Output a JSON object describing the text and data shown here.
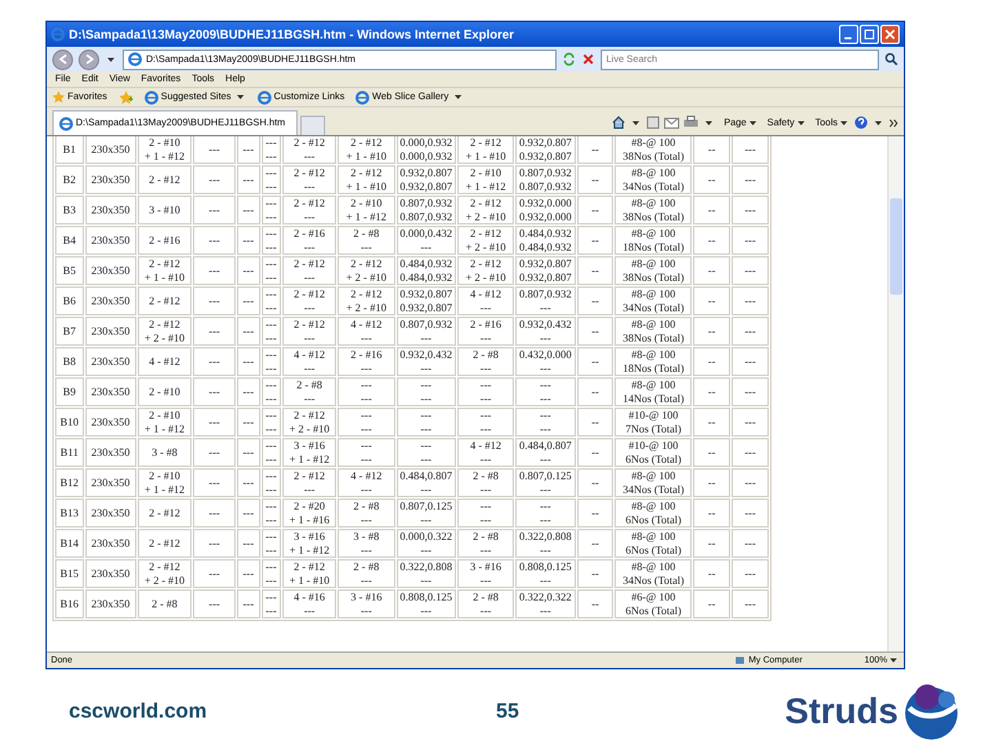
{
  "window": {
    "title": "D:\\Sampada1\\13May2009\\BUDHEJ11BGSH.htm - Windows Internet Explorer"
  },
  "address_bar": {
    "value": "D:\\Sampada1\\13May2009\\BUDHEJ11BGSH.htm"
  },
  "search": {
    "placeholder": "Live Search"
  },
  "menu": [
    "File",
    "Edit",
    "View",
    "Favorites",
    "Tools",
    "Help"
  ],
  "favorites_bar": {
    "favorites": "Favorites",
    "links": [
      {
        "label": "Suggested Sites",
        "dropdown": true
      },
      {
        "label": "Customize Links",
        "dropdown": false
      },
      {
        "label": "Web Slice Gallery",
        "dropdown": true
      }
    ]
  },
  "tabs": [
    {
      "label": "D:\\Sampada1\\13May2009\\BUDHEJ11BGSH.htm",
      "selected": true
    }
  ],
  "command_bar": [
    "Page",
    "Safety",
    "Tools"
  ],
  "table": {
    "rows": [
      [
        [
          "B1"
        ],
        [
          "230x350"
        ],
        [
          "2 - #10",
          "+ 1 - #12"
        ],
        [
          "---"
        ],
        [
          "---"
        ],
        [
          "---",
          "---"
        ],
        [
          "2 - #12",
          "---"
        ],
        [
          "2 - #12",
          "+ 1 - #10"
        ],
        [
          "0.000,0.932",
          "0.000,0.932"
        ],
        [
          "2 - #12",
          "+ 1 - #10"
        ],
        [
          "0.932,0.807",
          "0.932,0.807"
        ],
        [
          "--"
        ],
        [
          "#8-@ 100",
          "38Nos (Total)"
        ],
        [
          "--"
        ],
        [
          "---"
        ]
      ],
      [
        [
          "B2"
        ],
        [
          "230x350"
        ],
        [
          "2 - #12"
        ],
        [
          "---"
        ],
        [
          "---"
        ],
        [
          "---",
          "---"
        ],
        [
          "2 - #12",
          "---"
        ],
        [
          "2 - #12",
          "+ 1 - #10"
        ],
        [
          "0.932,0.807",
          "0.932,0.807"
        ],
        [
          "2 - #10",
          "+ 1 - #12"
        ],
        [
          "0.807,0.932",
          "0.807,0.932"
        ],
        [
          "--"
        ],
        [
          "#8-@ 100",
          "34Nos (Total)"
        ],
        [
          "--"
        ],
        [
          "---"
        ]
      ],
      [
        [
          "B3"
        ],
        [
          "230x350"
        ],
        [
          "3 - #10"
        ],
        [
          "---"
        ],
        [
          "---"
        ],
        [
          "---",
          "---"
        ],
        [
          "2 - #12",
          "---"
        ],
        [
          "2 - #10",
          "+ 1 - #12"
        ],
        [
          "0.807,0.932",
          "0.807,0.932"
        ],
        [
          "2 - #12",
          "+ 2 - #10"
        ],
        [
          "0.932,0.000",
          "0.932,0.000"
        ],
        [
          "--"
        ],
        [
          "#8-@ 100",
          "38Nos (Total)"
        ],
        [
          "--"
        ],
        [
          "---"
        ]
      ],
      [
        [
          "B4"
        ],
        [
          "230x350"
        ],
        [
          "2 - #16"
        ],
        [
          "---"
        ],
        [
          "---"
        ],
        [
          "---",
          "---"
        ],
        [
          "2 - #16",
          "---"
        ],
        [
          "2 - #8",
          "---"
        ],
        [
          "0.000,0.432",
          "---"
        ],
        [
          "2 - #12",
          "+ 2 - #10"
        ],
        [
          "0.484,0.932",
          "0.484,0.932"
        ],
        [
          "--"
        ],
        [
          "#8-@ 100",
          "18Nos (Total)"
        ],
        [
          "--"
        ],
        [
          "---"
        ]
      ],
      [
        [
          "B5"
        ],
        [
          "230x350"
        ],
        [
          "2 - #12",
          "+ 1 - #10"
        ],
        [
          "---"
        ],
        [
          "---"
        ],
        [
          "---",
          "---"
        ],
        [
          "2 - #12",
          "---"
        ],
        [
          "2 - #12",
          "+ 2 - #10"
        ],
        [
          "0.484,0.932",
          "0.484,0.932"
        ],
        [
          "2 - #12",
          "+ 2 - #10"
        ],
        [
          "0.932,0.807",
          "0.932,0.807"
        ],
        [
          "--"
        ],
        [
          "#8-@ 100",
          "38Nos (Total)"
        ],
        [
          "--"
        ],
        [
          "---"
        ]
      ],
      [
        [
          "B6"
        ],
        [
          "230x350"
        ],
        [
          "2 - #12"
        ],
        [
          "---"
        ],
        [
          "---"
        ],
        [
          "---",
          "---"
        ],
        [
          "2 - #12",
          "---"
        ],
        [
          "2 - #12",
          "+ 2 - #10"
        ],
        [
          "0.932,0.807",
          "0.932,0.807"
        ],
        [
          "4 - #12",
          "---"
        ],
        [
          "0.807,0.932",
          "---"
        ],
        [
          "--"
        ],
        [
          "#8-@ 100",
          "34Nos (Total)"
        ],
        [
          "--"
        ],
        [
          "---"
        ]
      ],
      [
        [
          "B7"
        ],
        [
          "230x350"
        ],
        [
          "2 - #12",
          "+ 2 - #10"
        ],
        [
          "---"
        ],
        [
          "---"
        ],
        [
          "---",
          "---"
        ],
        [
          "2 - #12",
          "---"
        ],
        [
          "4 - #12",
          "---"
        ],
        [
          "0.807,0.932",
          "---"
        ],
        [
          "2 - #16",
          "---"
        ],
        [
          "0.932,0.432",
          "---"
        ],
        [
          "--"
        ],
        [
          "#8-@ 100",
          "38Nos (Total)"
        ],
        [
          "--"
        ],
        [
          "---"
        ]
      ],
      [
        [
          "B8"
        ],
        [
          "230x350"
        ],
        [
          "4 - #12"
        ],
        [
          "---"
        ],
        [
          "---"
        ],
        [
          "---",
          "---"
        ],
        [
          "4 - #12",
          "---"
        ],
        [
          "2 - #16",
          "---"
        ],
        [
          "0.932,0.432",
          "---"
        ],
        [
          "2 - #8",
          "---"
        ],
        [
          "0.432,0.000",
          "---"
        ],
        [
          "--"
        ],
        [
          "#8-@ 100",
          "18Nos (Total)"
        ],
        [
          "--"
        ],
        [
          "---"
        ]
      ],
      [
        [
          "B9"
        ],
        [
          "230x350"
        ],
        [
          "2 - #10"
        ],
        [
          "---"
        ],
        [
          "---"
        ],
        [
          "---",
          "---"
        ],
        [
          "2 - #8",
          "---"
        ],
        [
          "---",
          "---"
        ],
        [
          "---",
          "---"
        ],
        [
          "---",
          "---"
        ],
        [
          "---",
          "---"
        ],
        [
          "--"
        ],
        [
          "#8-@ 100",
          "14Nos (Total)"
        ],
        [
          "--"
        ],
        [
          "---"
        ]
      ],
      [
        [
          "B10"
        ],
        [
          "230x350"
        ],
        [
          "2 - #10",
          "+ 1 - #12"
        ],
        [
          "---"
        ],
        [
          "---"
        ],
        [
          "---",
          "---"
        ],
        [
          "2 - #12",
          "+ 2 - #10"
        ],
        [
          "---",
          "---"
        ],
        [
          "---",
          "---"
        ],
        [
          "---",
          "---"
        ],
        [
          "---",
          "---"
        ],
        [
          "--"
        ],
        [
          "#10-@ 100",
          "7Nos (Total)"
        ],
        [
          "--"
        ],
        [
          "---"
        ]
      ],
      [
        [
          "B11"
        ],
        [
          "230x350"
        ],
        [
          "3 - #8"
        ],
        [
          "---"
        ],
        [
          "---"
        ],
        [
          "---",
          "---"
        ],
        [
          "3 - #16",
          "+ 1 - #12"
        ],
        [
          "---",
          "---"
        ],
        [
          "---",
          "---"
        ],
        [
          "4 - #12",
          "---"
        ],
        [
          "0.484,0.807",
          "---"
        ],
        [
          "--"
        ],
        [
          "#10-@ 100",
          "6Nos (Total)"
        ],
        [
          "--"
        ],
        [
          "---"
        ]
      ],
      [
        [
          "B12"
        ],
        [
          "230x350"
        ],
        [
          "2 - #10",
          "+ 1 - #12"
        ],
        [
          "---"
        ],
        [
          "---"
        ],
        [
          "---",
          "---"
        ],
        [
          "2 - #12",
          "---"
        ],
        [
          "4 - #12",
          "---"
        ],
        [
          "0.484,0.807",
          "---"
        ],
        [
          "2 - #8",
          "---"
        ],
        [
          "0.807,0.125",
          "---"
        ],
        [
          "--"
        ],
        [
          "#8-@ 100",
          "34Nos (Total)"
        ],
        [
          "--"
        ],
        [
          "---"
        ]
      ],
      [
        [
          "B13"
        ],
        [
          "230x350"
        ],
        [
          "2 - #12"
        ],
        [
          "---"
        ],
        [
          "---"
        ],
        [
          "---",
          "---"
        ],
        [
          "2 - #20",
          "+ 1 - #16"
        ],
        [
          "2 - #8",
          "---"
        ],
        [
          "0.807,0.125",
          "---"
        ],
        [
          "---",
          "---"
        ],
        [
          "---",
          "---"
        ],
        [
          "--"
        ],
        [
          "#8-@ 100",
          "6Nos (Total)"
        ],
        [
          "--"
        ],
        [
          "---"
        ]
      ],
      [
        [
          "B14"
        ],
        [
          "230x350"
        ],
        [
          "2 - #12"
        ],
        [
          "---"
        ],
        [
          "---"
        ],
        [
          "---",
          "---"
        ],
        [
          "3 - #16",
          "+ 1 - #12"
        ],
        [
          "3 - #8",
          "---"
        ],
        [
          "0.000,0.322",
          "---"
        ],
        [
          "2 - #8",
          "---"
        ],
        [
          "0.322,0.808",
          "---"
        ],
        [
          "--"
        ],
        [
          "#8-@ 100",
          "6Nos (Total)"
        ],
        [
          "--"
        ],
        [
          "---"
        ]
      ],
      [
        [
          "B15"
        ],
        [
          "230x350"
        ],
        [
          "2 - #12",
          "+ 2 - #10"
        ],
        [
          "---"
        ],
        [
          "---"
        ],
        [
          "---",
          "---"
        ],
        [
          "2 - #12",
          "+ 1 - #10"
        ],
        [
          "2 - #8",
          "---"
        ],
        [
          "0.322,0.808",
          "---"
        ],
        [
          "3 - #16",
          "---"
        ],
        [
          "0.808,0.125",
          "---"
        ],
        [
          "--"
        ],
        [
          "#8-@ 100",
          "34Nos (Total)"
        ],
        [
          "--"
        ],
        [
          "---"
        ]
      ],
      [
        [
          "B16"
        ],
        [
          "230x350"
        ],
        [
          "2 - #8"
        ],
        [
          "---"
        ],
        [
          "---"
        ],
        [
          "---",
          "---"
        ],
        [
          "4 - #16",
          "---"
        ],
        [
          "3 - #16",
          "---"
        ],
        [
          "0.808,0.125",
          "---"
        ],
        [
          "2 - #8",
          "---"
        ],
        [
          "0.322,0.322",
          "---"
        ],
        [
          "--"
        ],
        [
          "#6-@ 100",
          "6Nos (Total)"
        ],
        [
          "--"
        ],
        [
          "---"
        ]
      ]
    ]
  },
  "status_bar": {
    "status": "Done",
    "zone": "My Computer",
    "zoom": "100%"
  },
  "slide_footer": {
    "website": "cscworld.com",
    "page_number": "55",
    "logo_text": "Struds"
  }
}
